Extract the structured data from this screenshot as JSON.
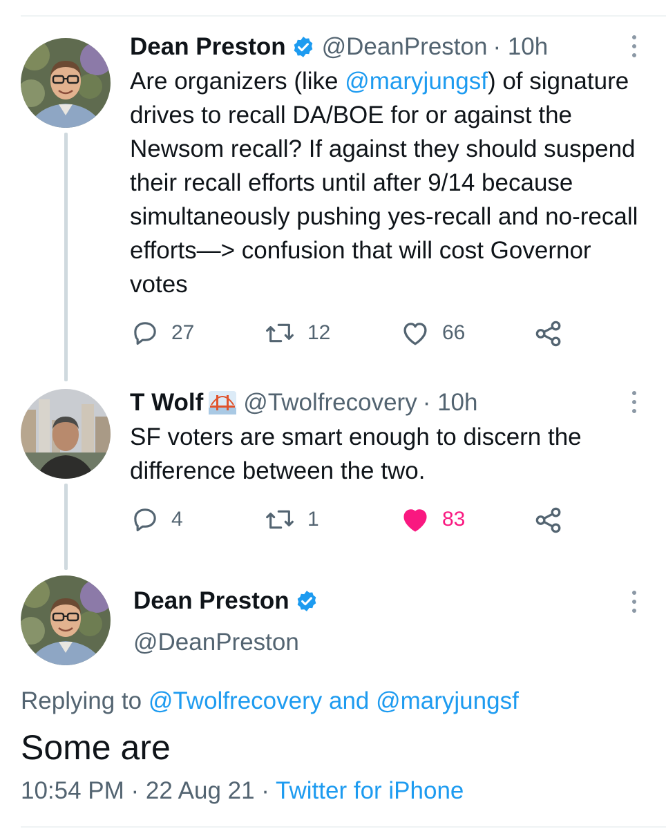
{
  "tweet1": {
    "name": "Dean Preston",
    "handle": "@DeanPreston",
    "time": "· 10h",
    "text_before": "Are organizers (like ",
    "mention": "@maryjungsf",
    "text_after": ") of signature drives to recall DA/BOE for or against the Newsom recall? If against they should suspend their recall efforts until after 9/14 because  simultaneously pushing yes-recall and no-recall efforts—> confusion that will cost Governor votes",
    "replies": "27",
    "retweets": "12",
    "likes": "66",
    "liked": false
  },
  "tweet2": {
    "name": "T Wolf",
    "handle": "@Twolfrecovery",
    "time": "· 10h",
    "text": "SF voters are smart enough to discern the difference between the two.",
    "replies": "4",
    "retweets": "1",
    "likes": "83",
    "liked": true
  },
  "main": {
    "name": "Dean Preston",
    "handle": "@DeanPreston",
    "replying_prefix": "Replying to ",
    "replying_to": "@Twolfrecovery and @maryjungsf",
    "text": "Some are",
    "timestamp": "10:54 PM · 22 Aug 21 · ",
    "source": "Twitter for iPhone"
  },
  "colors": {
    "accent": "#1d9bf0",
    "like": "#f91880",
    "muted": "#536471"
  },
  "icons": {
    "verified": "verified-badge-icon",
    "reply": "reply-icon",
    "retweet": "retweet-icon",
    "like": "like-icon",
    "share": "share-icon",
    "more": "more-icon"
  }
}
